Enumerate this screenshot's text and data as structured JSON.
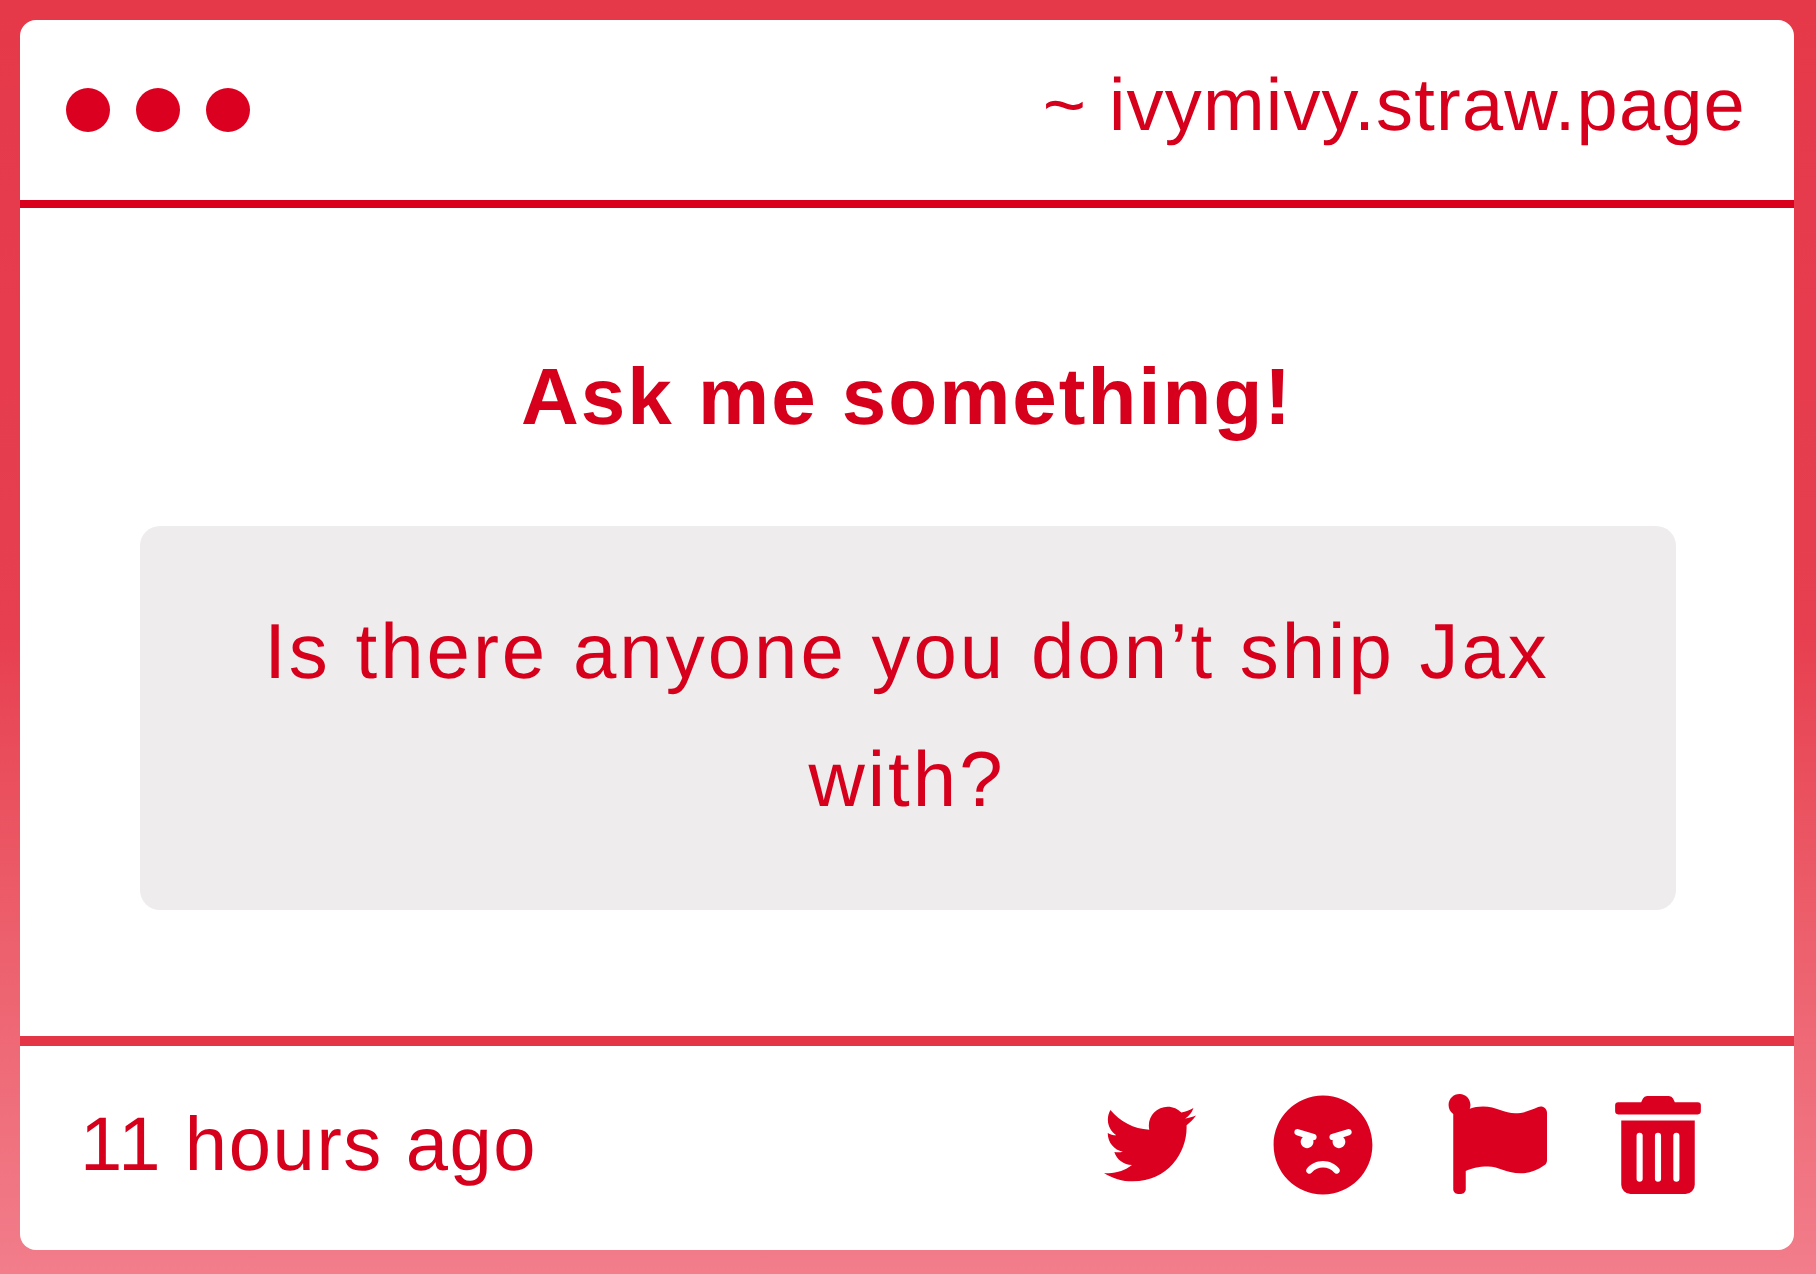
{
  "header": {
    "address": "~ ivymivy.straw.page"
  },
  "prompt": {
    "title": "Ask me something!",
    "question": "Is there anyone you don’t ship Jax with?"
  },
  "footer": {
    "time": "11 hours ago"
  }
}
